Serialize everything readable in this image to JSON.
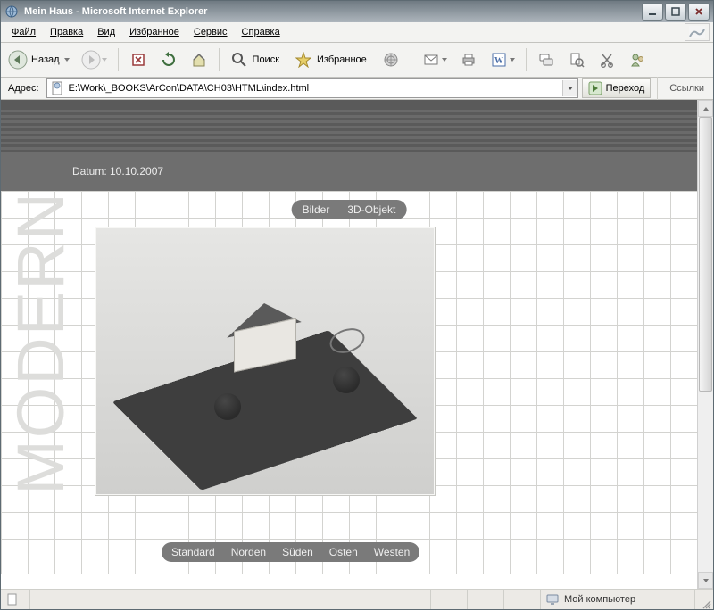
{
  "window": {
    "title": "Mein Haus - Microsoft Internet Explorer"
  },
  "menu": {
    "file": "Файл",
    "edit": "Правка",
    "view": "Вид",
    "favorites": "Избранное",
    "tools": "Сервис",
    "help": "Справка"
  },
  "toolbar": {
    "back_label": "Назад",
    "back_icon": "back-arrow-icon",
    "forward_icon": "forward-arrow-icon",
    "stop_icon": "stop-icon",
    "refresh_icon": "refresh-icon",
    "home_icon": "home-icon",
    "search_label": "Поиск",
    "search_icon": "search-icon",
    "favorites_label": "Избранное",
    "favorites_icon": "star-icon",
    "media_icon": "media-icon",
    "mail_icon": "mail-icon",
    "print_icon": "print-icon",
    "edit_icon": "word-icon",
    "discuss_icon": "discuss-icon",
    "research_icon": "research-icon",
    "cut_icon": "cut-icon",
    "messenger_icon": "messenger-icon"
  },
  "addressbar": {
    "label": "Адрес:",
    "url": "E:\\Work\\_BOOKS\\ArCon\\DATA\\CH03\\HTML\\index.html",
    "go_label": "Переход",
    "links_label": "Ссылки"
  },
  "page": {
    "side_text": "MODERN",
    "date_label": "Datum: 10.10.2007",
    "tabs": {
      "bilder": "Bilder",
      "objekt": "3D-Objekt"
    },
    "views": {
      "standard": "Standard",
      "norden": "Norden",
      "suden": "Süden",
      "osten": "Osten",
      "westen": "Westen"
    }
  },
  "status": {
    "zone": "Мой компьютер"
  }
}
